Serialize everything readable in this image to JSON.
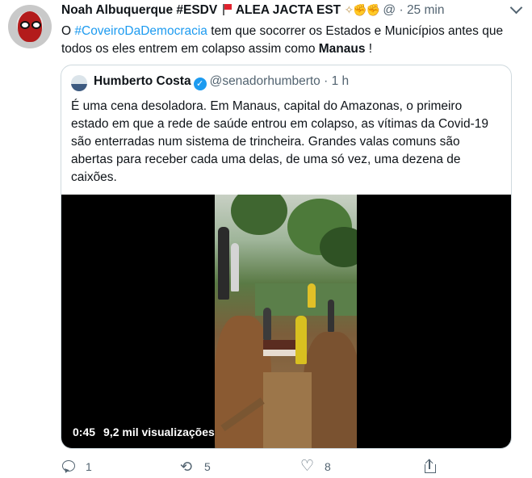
{
  "tweet": {
    "author_name": "Noah Albuquerque #ESDV",
    "author_suffix": "ALEA JACTA EST",
    "handle": "@",
    "time": "25 min",
    "text": {
      "before": "O ",
      "hashtag": "#CoveiroDaDemocracia",
      "middle": " tem que socorrer os Estados e Municípios antes que todos os  eles entrem em colapso assim como ",
      "bold": "Manaus",
      "after": " !"
    },
    "icons": {
      "avatar": "deadpool-avatar",
      "flag": "red-flag-emoji",
      "emojis": [
        "clinking-glasses-emoji",
        "fist-bump-emoji",
        "fist-bump-emoji"
      ],
      "more": "chevron-down-icon"
    }
  },
  "quoted": {
    "author_name": "Humberto Costa",
    "verified": "✓",
    "handle": "@senadorhumberto",
    "time": "1 h",
    "text": "É uma cena desoladora. Em Manaus, capital do Amazonas, o primeiro estado em que a rede de saúde entrou em colapso, as vítimas da Covid-19 são enterradas num sistema de trincheira. Grandes valas comuns são abertas para receber cada uma delas, de uma só vez, uma dezena de caixões.",
    "video": {
      "duration": "0:45",
      "views": "9,2 mil visualizações"
    }
  },
  "actions": {
    "reply_count": "1",
    "retweet_count": "5",
    "like_count": "8",
    "reply_icon": "reply-icon",
    "retweet_icon": "retweet-icon",
    "like_icon": "heart-icon",
    "share_icon": "share-icon"
  },
  "colors": {
    "link": "#1d9bf0",
    "secondary_text": "#536471",
    "border": "#cfd9de",
    "flag_red": "#e0232e"
  }
}
